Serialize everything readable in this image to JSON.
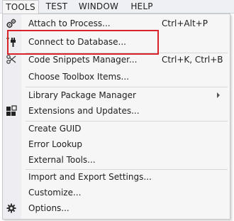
{
  "menubar": {
    "tools": "TOOLS",
    "test": "TEST",
    "window": "WINDOW",
    "help": "HELP"
  },
  "menu": {
    "attach": {
      "label": "Attach to Process...",
      "shortcut": "Ctrl+Alt+P",
      "icon": "gears-icon"
    },
    "connect": {
      "label": "Connect to Database...",
      "icon": "database-plug-icon"
    },
    "snippets": {
      "label": "Code Snippets Manager...",
      "shortcut": "Ctrl+K, Ctrl+B",
      "icon": "snippet-icon"
    },
    "toolbox": {
      "label": "Choose Toolbox Items..."
    },
    "library": {
      "label": "Library Package Manager"
    },
    "extensions": {
      "label": "Extensions and Updates...",
      "icon": "extensions-icon"
    },
    "guid": {
      "label": "Create GUID"
    },
    "error": {
      "label": "Error Lookup"
    },
    "external": {
      "label": "External Tools..."
    },
    "import": {
      "label": "Import and Export Settings..."
    },
    "customize": {
      "label": "Customize..."
    },
    "options": {
      "label": "Options...",
      "icon": "gear-icon"
    }
  },
  "colors": {
    "highlight_box": "#d9232a",
    "menu_background": "#f6f6f6"
  }
}
